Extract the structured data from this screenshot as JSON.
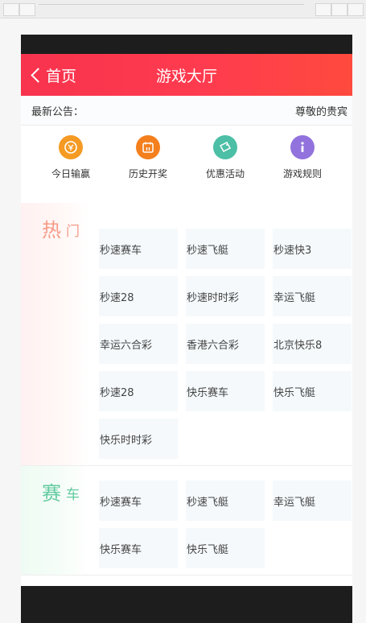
{
  "header": {
    "back_label": "首页",
    "title": "游戏大厅"
  },
  "notice": {
    "label": "最新公告：",
    "text": "尊敬的贵宾"
  },
  "quick_links": [
    {
      "label": "今日输赢",
      "icon": "coin-icon",
      "color": "#f59a23"
    },
    {
      "label": "历史开奖",
      "icon": "calendar-icon",
      "color": "#f47f1d"
    },
    {
      "label": "优惠活动",
      "icon": "ticket-icon",
      "color": "#4cbfa6"
    },
    {
      "label": "游戏规则",
      "icon": "info-icon",
      "color": "#9273dd"
    }
  ],
  "sections": [
    {
      "title_big": "热",
      "title_small": "门",
      "games": [
        "秒速赛车",
        "秒速飞艇",
        "秒速快3",
        "秒速28",
        "秒速时时彩",
        "幸运飞艇",
        "幸运六合彩",
        "香港六合彩",
        "北京快乐8",
        "秒速28",
        "快乐赛车",
        "快乐飞艇",
        "快乐时时彩"
      ]
    },
    {
      "title_big": "赛",
      "title_small": "车",
      "games": [
        "秒速赛车",
        "秒速飞艇",
        "幸运飞艇",
        "快乐赛车",
        "快乐飞艇"
      ]
    }
  ]
}
